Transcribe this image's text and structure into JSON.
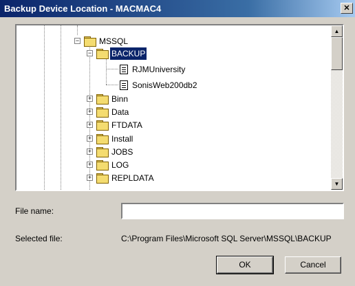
{
  "window": {
    "title": "Backup Device Location - MACMAC4",
    "close_label": "✕"
  },
  "tree": {
    "root": {
      "label": "MSSQL",
      "expander": "−"
    },
    "selected": {
      "label": "BACKUP",
      "expander": "−"
    },
    "files": [
      "RJMUniversity",
      "SonisWeb200db2"
    ],
    "folders": [
      "Binn",
      "Data",
      "FTDATA",
      "Install",
      "JOBS",
      "LOG",
      "REPLDATA"
    ],
    "collapsed_expander": "+"
  },
  "scrollbar": {
    "up": "▲",
    "down": "▼"
  },
  "form": {
    "file_name_label": "File name:",
    "file_name_value": "",
    "selected_file_label": "Selected file:",
    "selected_file_value": "C:\\Program Files\\Microsoft SQL Server\\MSSQL\\BACKUP"
  },
  "buttons": {
    "ok": "OK",
    "cancel": "Cancel"
  }
}
